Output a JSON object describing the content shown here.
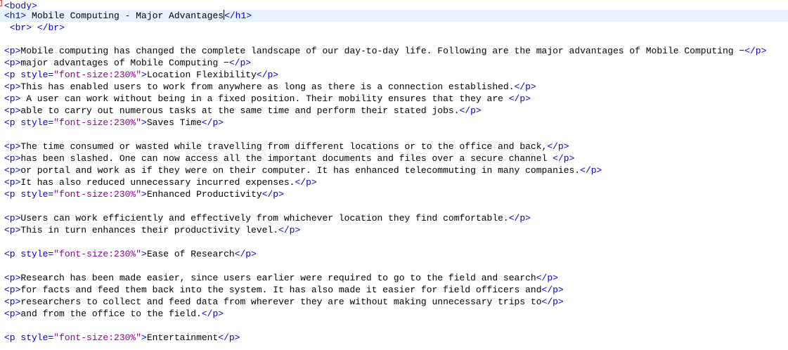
{
  "editor": {
    "colors": {
      "tag": "#0000c8",
      "attribute_value": "#8b008b",
      "text": "#000000",
      "current_line": "#e8f2fe",
      "background": "#ffffff"
    },
    "lines": [
      {
        "text": "<body>"
      },
      {
        "text": "<h1> Mobile Computing - Major Advantages</h1>"
      },
      {
        "text": " <br> </br>"
      },
      {
        "text": ""
      },
      {
        "text": "<p>Mobile computing has changed the complete landscape of our day-to-day life. Following are the major advantages of Mobile Computing −</p>"
      },
      {
        "text": "<p>major advantages of Mobile Computing −</p>"
      },
      {
        "text": "<p style=\"font-size:230%\">Location Flexibility</p>"
      },
      {
        "text": "<p>This has enabled users to work from anywhere as long as there is a connection established.</p>"
      },
      {
        "text": "<p> A user can work without being in a fixed position. Their mobility ensures that they are </p>"
      },
      {
        "text": "<p>able to carry out numerous tasks at the same time and perform their stated jobs.</p>"
      },
      {
        "text": "<p style=\"font-size:230%\">Saves Time</p>"
      },
      {
        "text": ""
      },
      {
        "text": "<p>The time consumed or wasted while travelling from different locations or to the office and back,</p>"
      },
      {
        "text": "<p>has been slashed. One can now access all the important documents and files over a secure channel </p>"
      },
      {
        "text": "<p>or portal and work as if they were on their computer. It has enhanced telecommuting in many companies.</p>"
      },
      {
        "text": "<p>It has also reduced unnecessary incurred expenses.</p>"
      },
      {
        "text": "<p style=\"font-size:230%\">Enhanced Productivity</p>"
      },
      {
        "text": ""
      },
      {
        "text": "<p>Users can work efficiently and effectively from whichever location they find comfortable.</p>"
      },
      {
        "text": "<p>This in turn enhances their productivity level.</p>"
      },
      {
        "text": ""
      },
      {
        "text": "<p style=\"font-size:230%\">Ease of Research</p>"
      },
      {
        "text": ""
      },
      {
        "text": "<p>Research has been made easier, since users earlier were required to go to the field and search</p>"
      },
      {
        "text": "<p>for facts and feed them back into the system. It has also made it easier for field officers and</p>"
      },
      {
        "text": "<p>researchers to collect and feed data from wherever they are without making unnecessary trips to</p>"
      },
      {
        "text": "<p>and from the office to the field.</p>"
      },
      {
        "text": ""
      },
      {
        "text": "<p style=\"font-size:230%\">Entertainment</p>"
      }
    ]
  }
}
